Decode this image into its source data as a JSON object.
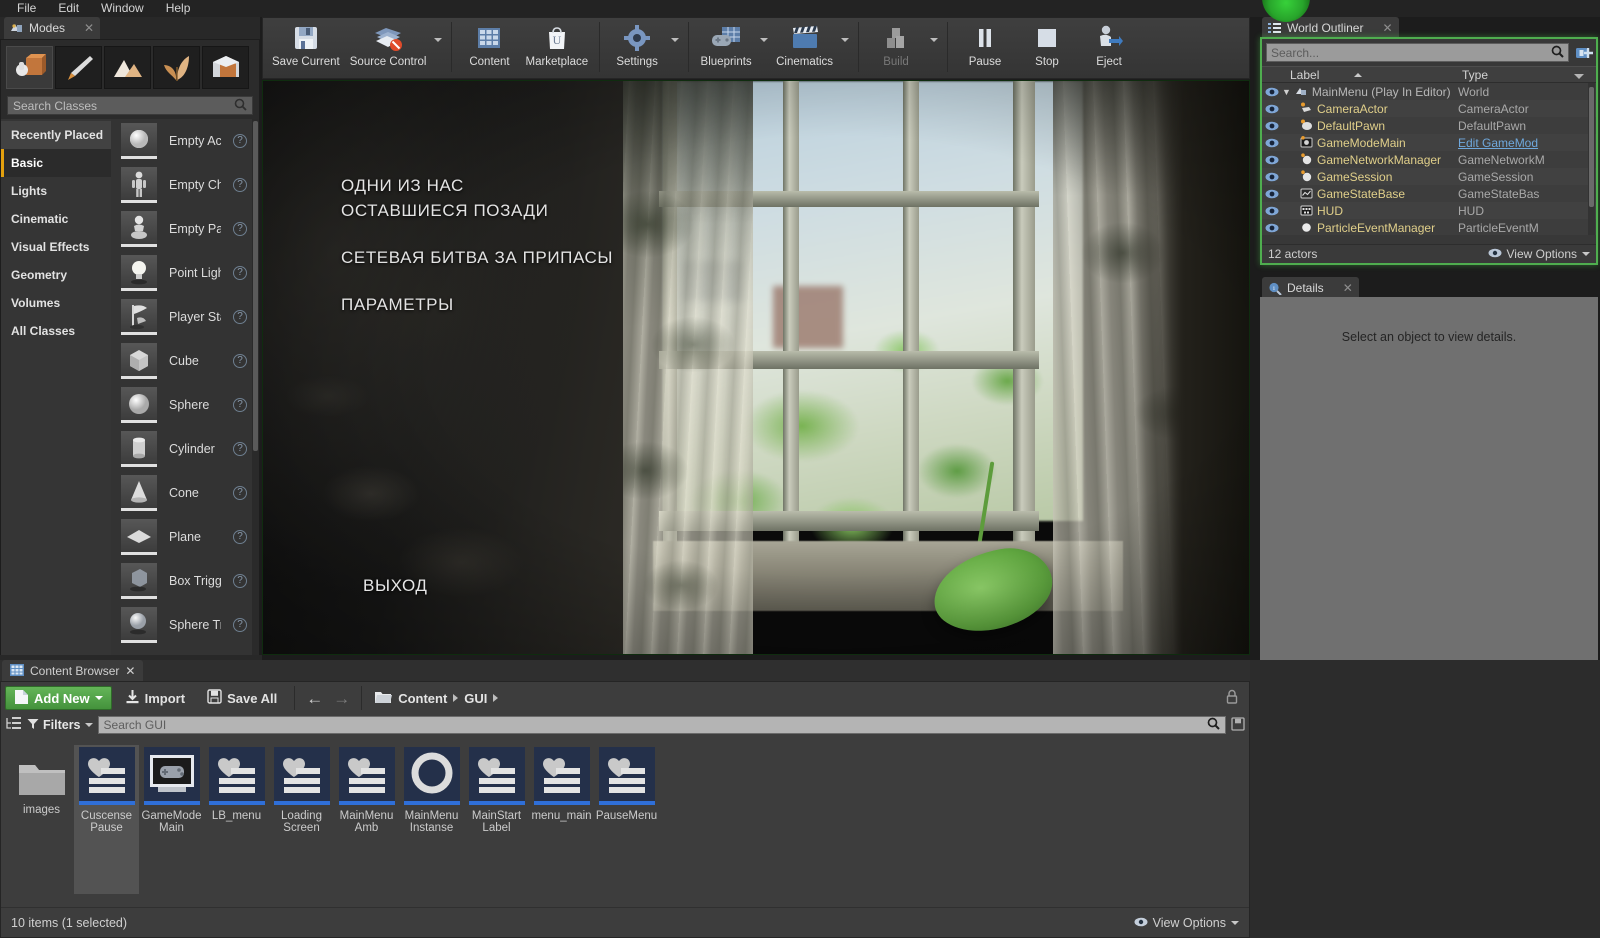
{
  "menubar": {
    "items": [
      "File",
      "Edit",
      "Window",
      "Help"
    ]
  },
  "modes": {
    "tab_label": "Modes",
    "tab_icon": "modes-icon",
    "close_icon": "close-icon",
    "mode_buttons": [
      {
        "name": "place-mode",
        "icon": "place-mode-icon",
        "active": true
      },
      {
        "name": "paint-mode",
        "icon": "paint-brush-icon",
        "active": false
      },
      {
        "name": "landscape-mode",
        "icon": "landscape-icon",
        "active": false
      },
      {
        "name": "foliage-mode",
        "icon": "foliage-leaf-icon",
        "active": false
      },
      {
        "name": "geometry-mode",
        "icon": "geometry-box-icon",
        "active": false
      }
    ],
    "search": {
      "value": "",
      "placeholder": "Search Classes",
      "icon": "search-icon"
    },
    "categories": [
      {
        "label": "Recently Placed",
        "selected": false,
        "highlight": true
      },
      {
        "label": "Basic",
        "selected": true,
        "highlight": false
      },
      {
        "label": "Lights",
        "selected": false,
        "highlight": false
      },
      {
        "label": "Cinematic",
        "selected": false,
        "highlight": false
      },
      {
        "label": "Visual Effects",
        "selected": false,
        "highlight": false
      },
      {
        "label": "Geometry",
        "selected": false,
        "highlight": false
      },
      {
        "label": "Volumes",
        "selected": false,
        "highlight": false
      },
      {
        "label": "All Classes",
        "selected": false,
        "highlight": false
      }
    ],
    "items": [
      {
        "label": "Empty Actor",
        "icon": "empty-actor-icon"
      },
      {
        "label": "Empty Charac",
        "icon": "empty-character-icon"
      },
      {
        "label": "Empty Pawn",
        "icon": "empty-pawn-icon"
      },
      {
        "label": "Point Light",
        "icon": "point-light-icon"
      },
      {
        "label": "Player Start",
        "icon": "player-start-icon"
      },
      {
        "label": "Cube",
        "icon": "cube-icon"
      },
      {
        "label": "Sphere",
        "icon": "sphere-icon"
      },
      {
        "label": "Cylinder",
        "icon": "cylinder-icon"
      },
      {
        "label": "Cone",
        "icon": "cone-icon"
      },
      {
        "label": "Plane",
        "icon": "plane-icon"
      },
      {
        "label": "Box Trigger",
        "icon": "box-trigger-icon"
      },
      {
        "label": "Sphere Trigge",
        "icon": "sphere-trigger-icon"
      }
    ],
    "help_icon": "help-icon"
  },
  "toolbar": {
    "groups": [
      [
        {
          "label": "Save Current",
          "icon": "save-icon",
          "arrow": false,
          "disabled": false
        },
        {
          "label": "Source Control",
          "icon": "source-control-icon",
          "arrow": true,
          "disabled": false
        }
      ],
      [
        {
          "label": "Content",
          "icon": "content-icon",
          "arrow": false,
          "disabled": false
        },
        {
          "label": "Marketplace",
          "icon": "marketplace-icon",
          "arrow": false,
          "disabled": false
        }
      ],
      [
        {
          "label": "Settings",
          "icon": "settings-gear-icon",
          "arrow": true,
          "disabled": false
        }
      ],
      [
        {
          "label": "Blueprints",
          "icon": "blueprints-icon",
          "arrow": true,
          "disabled": false
        },
        {
          "label": "Cinematics",
          "icon": "cinematics-clapper-icon",
          "arrow": true,
          "disabled": false
        }
      ],
      [
        {
          "label": "Build",
          "icon": "build-icon",
          "arrow": true,
          "disabled": true
        }
      ],
      [
        {
          "label": "Pause",
          "icon": "pause-icon",
          "arrow": false,
          "disabled": false
        },
        {
          "label": "Stop",
          "icon": "stop-icon",
          "arrow": false,
          "disabled": false
        },
        {
          "label": "Eject",
          "icon": "eject-icon",
          "arrow": false,
          "disabled": false
        }
      ]
    ]
  },
  "viewport": {
    "pie_active": true,
    "pie_border_color": "#4fae4f",
    "game_menu": {
      "title_lines": [
        "ОДНИ ИЗ НАС",
        "ОСТАВШИЕСЯ ПОЗАДИ"
      ],
      "subtitle": "СЕТЕВАЯ БИТВА ЗА ПРИПАСЫ",
      "options_label": "ПАРАМЕТРЫ",
      "exit_label": "ВЫХОД"
    }
  },
  "outliner": {
    "tab_label": "World Outliner",
    "tab_icon": "outliner-icon",
    "close_icon": "close-icon",
    "search": {
      "value": "",
      "placeholder": "Search...",
      "icon": "search-icon"
    },
    "add_icon": "add-actor-icon",
    "columns": {
      "label": "Label",
      "type": "Type"
    },
    "rows": [
      {
        "label": "MainMenu (Play In Editor)",
        "type": "World",
        "icon": "world-icon",
        "indent": 0,
        "root": true,
        "type_link": false
      },
      {
        "label": "CameraActor",
        "type": "CameraActor",
        "icon": "camera-icon",
        "indent": 1,
        "root": false,
        "type_link": false
      },
      {
        "label": "DefaultPawn",
        "type": "DefaultPawn",
        "icon": "pawn-icon",
        "indent": 1,
        "root": false,
        "type_link": false
      },
      {
        "label": "GameModeMain",
        "type": "Edit GameMod",
        "icon": "gamemode-icon",
        "indent": 1,
        "root": false,
        "type_link": true
      },
      {
        "label": "GameNetworkManager",
        "type": "GameNetworkM",
        "icon": "sphere-actor-icon",
        "indent": 1,
        "root": false,
        "type_link": false
      },
      {
        "label": "GameSession",
        "type": "GameSession",
        "icon": "sphere-actor-icon",
        "indent": 1,
        "root": false,
        "type_link": false
      },
      {
        "label": "GameStateBase",
        "type": "GameStateBas",
        "icon": "gamestate-icon",
        "indent": 1,
        "root": false,
        "type_link": false
      },
      {
        "label": "HUD",
        "type": "HUD",
        "icon": "hud-icon",
        "indent": 1,
        "root": false,
        "type_link": false
      },
      {
        "label": "ParticleEventManager",
        "type": "ParticleEventM",
        "icon": "particle-icon",
        "indent": 1,
        "root": false,
        "type_link": false
      }
    ],
    "footer": {
      "count": "12 actors",
      "view_options": "View Options",
      "eye_icon": "eye-icon"
    },
    "eye_icon": "eye-icon"
  },
  "details": {
    "tab_label": "Details",
    "tab_icon": "details-icon",
    "close_icon": "close-icon",
    "empty_message": "Select an object to view details."
  },
  "content_browser": {
    "tab_label": "Content Browser",
    "tab_icon": "content-browser-icon",
    "close_icon": "close-icon",
    "add_new": {
      "label": "Add New",
      "icon": "new-asset-icon"
    },
    "import": {
      "label": "Import",
      "icon": "import-icon"
    },
    "save_all": {
      "label": "Save All",
      "icon": "save-all-icon"
    },
    "nav": {
      "back_icon": "arrow-left-icon",
      "forward_icon": "arrow-right-icon"
    },
    "breadcrumbs": [
      "Content",
      "GUI"
    ],
    "folder_icon": "folder-open-icon",
    "lock_icon": "lock-icon",
    "filters": {
      "label": "Filters",
      "icon": "filter-icon",
      "tree_icon": "sources-tree-icon"
    },
    "search": {
      "value": "",
      "placeholder": "Search GUI",
      "icon": "search-icon",
      "save-search-icon": "save-search-icon"
    },
    "assets": [
      {
        "name": "images",
        "type": "folder",
        "selected": false
      },
      {
        "name": "Cuscense\nPause",
        "label_l1": "Cuscense",
        "label_l2": "Pause",
        "type": "widget",
        "selected": true
      },
      {
        "name": "GameMode Main",
        "label_l1": "GameMode",
        "label_l2": "Main",
        "type": "gamemode",
        "selected": false
      },
      {
        "name": "LB_menu",
        "label_l1": "LB_menu",
        "label_l2": "",
        "type": "widget",
        "selected": false
      },
      {
        "name": "Loading Screen",
        "label_l1": "Loading",
        "label_l2": "Screen",
        "type": "widget",
        "selected": false
      },
      {
        "name": "MainMenu Amb",
        "label_l1": "MainMenu",
        "label_l2": "Amb",
        "type": "widget",
        "selected": false
      },
      {
        "name": "MainMenu Instanse",
        "label_l1": "MainMenu",
        "label_l2": "Instanse",
        "type": "material-instance",
        "selected": false
      },
      {
        "name": "MainStart Label",
        "label_l1": "MainStart",
        "label_l2": "Label",
        "type": "widget",
        "selected": false
      },
      {
        "name": "menu_main",
        "label_l1": "menu_main",
        "label_l2": "",
        "type": "widget",
        "selected": false
      },
      {
        "name": "PauseMenu",
        "label_l1": "PauseMenu",
        "label_l2": "",
        "type": "widget",
        "selected": false
      }
    ],
    "status": {
      "items": "10 items (1 selected)",
      "view_options": "View Options",
      "eye_icon": "eye-icon"
    }
  },
  "colors": {
    "accent_green": "#4fae4f",
    "add_new_green": "#55a34a",
    "selection_orange": "#e3a00e",
    "actor_label": "#e0cf8a",
    "link_blue": "#6fa8dc"
  }
}
